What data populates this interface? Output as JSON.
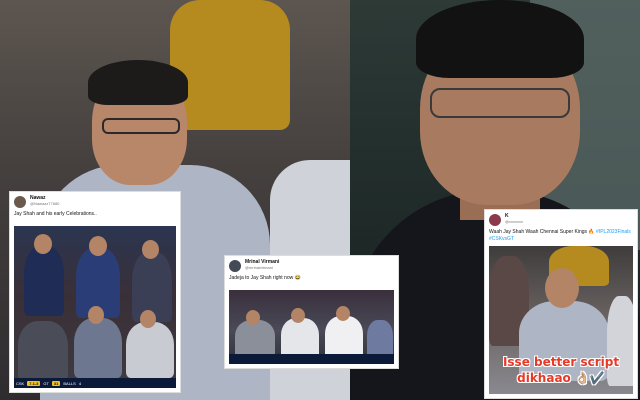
{
  "tweets": [
    {
      "name": "Nawaz",
      "handle": "@Nawazz77680",
      "text": "Jay Shah and his early Celebrations..",
      "avatar_color": "#6b5a4c",
      "scoreboard": {
        "team_a": "CSK",
        "score": "7.1-3",
        "team_b": "GT",
        "runs": "31",
        "balls_label": "BALLS",
        "balls": "4"
      }
    },
    {
      "name": "Mrinal Virmani",
      "handle": "@mrinalvirmani",
      "text": "Jadeja to Jay Shah right now 😂",
      "avatar_color": "#444a55"
    },
    {
      "name": "K",
      "handle": "@xxxxxxx",
      "text_main": "Waah Jay Shah Waah Chennai Super Kings 🔥",
      "text_tags": "#IPL2023Finals #CSKvsGT",
      "avatar_color": "#8c3a4b",
      "caption_line1": "Isse better script",
      "caption_line2": "dikhaao 👌🏼✔️"
    }
  ],
  "colors": {
    "caption": "#e63a28",
    "hashtag": "#1d9bf0",
    "scorebar": "#0c1a3a",
    "score_pill": "#f4c21b"
  }
}
